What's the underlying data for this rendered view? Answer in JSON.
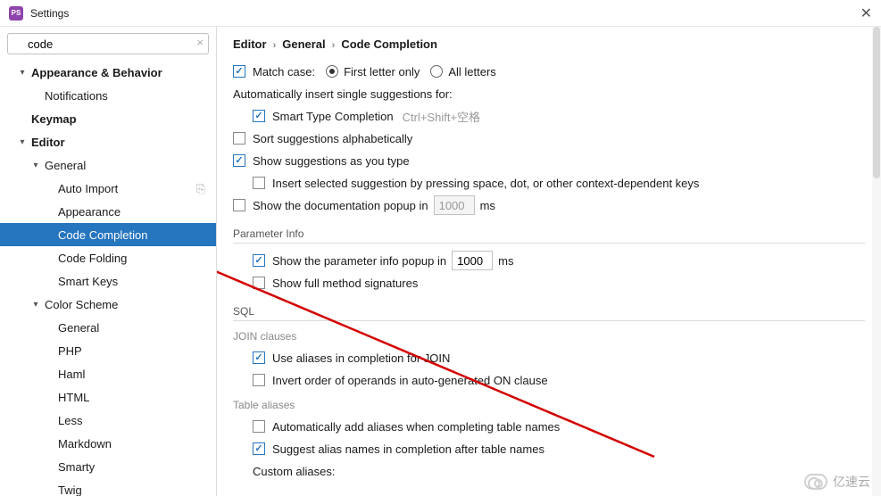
{
  "title": "Settings",
  "search": {
    "value": "code"
  },
  "tree": [
    {
      "label": "Appearance & Behavior",
      "depth": 1,
      "arrow": "v",
      "bold": true
    },
    {
      "label": "Notifications",
      "depth": 2
    },
    {
      "label": "Keymap",
      "depth": 1,
      "bold": true
    },
    {
      "label": "Editor",
      "depth": 1,
      "arrow": "v",
      "bold": true
    },
    {
      "label": "General",
      "depth": 2,
      "arrow": "v"
    },
    {
      "label": "Auto Import",
      "depth": 3,
      "badge": true
    },
    {
      "label": "Appearance",
      "depth": 3
    },
    {
      "label": "Code Completion",
      "depth": 3,
      "selected": true
    },
    {
      "label": "Code Folding",
      "depth": 3
    },
    {
      "label": "Smart Keys",
      "depth": 3
    },
    {
      "label": "Color Scheme",
      "depth": 2,
      "arrow": "v"
    },
    {
      "label": "General",
      "depth": 3
    },
    {
      "label": "PHP",
      "depth": 3
    },
    {
      "label": "Haml",
      "depth": 3
    },
    {
      "label": "HTML",
      "depth": 3
    },
    {
      "label": "Less",
      "depth": 3
    },
    {
      "label": "Markdown",
      "depth": 3
    },
    {
      "label": "Smarty",
      "depth": 3
    },
    {
      "label": "Twig",
      "depth": 3
    }
  ],
  "crumb": [
    "Editor",
    "General",
    "Code Completion"
  ],
  "opts": {
    "match_case": "Match case:",
    "first_letter": "First letter only",
    "all_letters": "All letters",
    "auto_insert": "Automatically insert single suggestions for:",
    "smart_type": "Smart Type Completion",
    "smart_shortcut": "Ctrl+Shift+空格",
    "sort_alpha": "Sort suggestions alphabetically",
    "show_type": "Show suggestions as you type",
    "insert_space": "Insert selected suggestion by pressing space, dot, or other context-dependent keys",
    "show_doc": "Show the documentation popup in",
    "doc_ms": "1000",
    "ms": "ms",
    "param_hd": "Parameter Info",
    "show_param": "Show the parameter info popup in",
    "param_ms": "1000",
    "show_full": "Show full method signatures",
    "sql_hd": "SQL",
    "join_hd": "JOIN clauses",
    "use_aliases": "Use aliases in completion for JOIN",
    "invert_order": "Invert order of operands in auto-generated ON clause",
    "table_hd": "Table aliases",
    "auto_alias": "Automatically add aliases when completing table names",
    "suggest_alias": "Suggest alias names in completion after table names",
    "custom_alias": "Custom aliases:"
  },
  "watermark": "亿速云"
}
